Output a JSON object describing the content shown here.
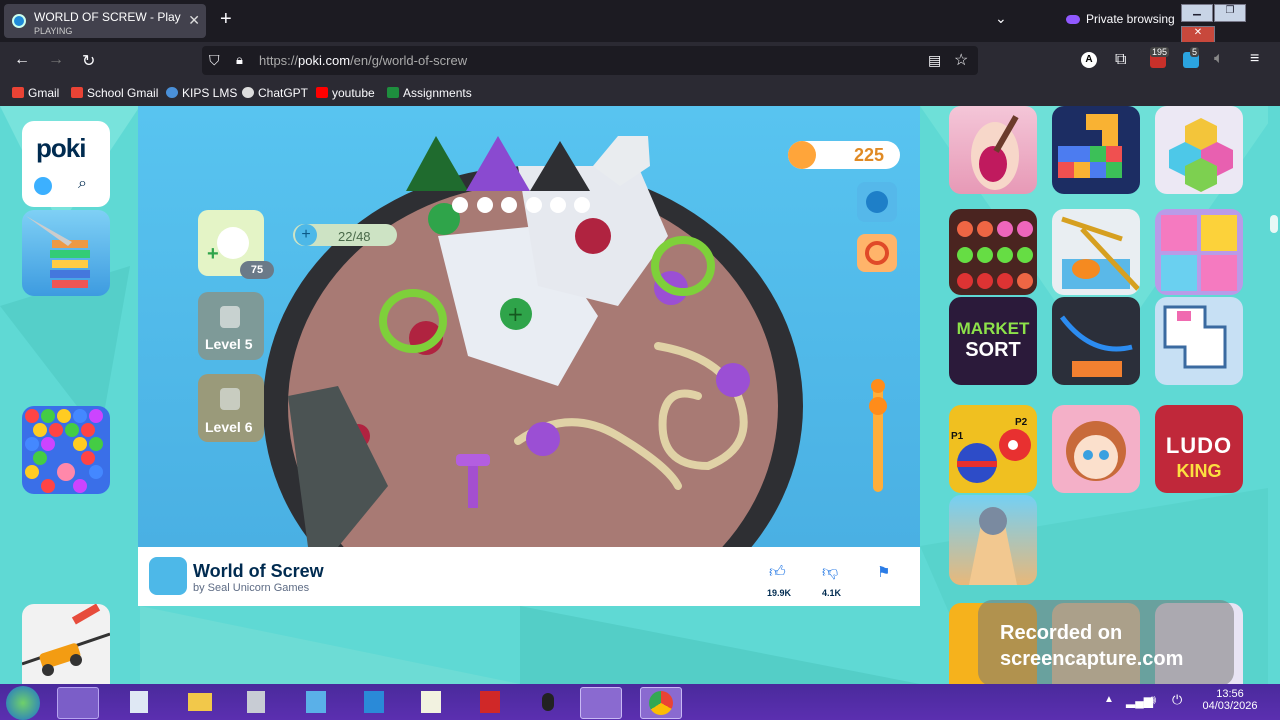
{
  "browser": {
    "tab": {
      "title": "WORLD OF SCREW - Play Onlin",
      "status": "PLAYING"
    },
    "new_tab": "+",
    "private_label": "Private browsing",
    "url": {
      "prefix": "https://",
      "host": "poki.com",
      "path": "/en/g/world-of-screw"
    },
    "extensions": {
      "badge1": "195",
      "badge2": "5"
    },
    "bookmarks": [
      "Gmail",
      "School Gmail",
      "KIPS LMS",
      "ChatGPT",
      "youtube",
      "Assignments"
    ]
  },
  "poki": {
    "logo": "poki"
  },
  "game": {
    "coins": "225",
    "progress": "22/48",
    "hint_cost": "75",
    "levels": [
      "Level 5",
      "Level 6"
    ]
  },
  "game_info": {
    "title": "World of Screw",
    "developer": "by Seal Unicorn Games",
    "likes": "19.9K",
    "dislikes": "4.1K"
  },
  "thumbs_text": {
    "market": "MARKET",
    "sort": "SORT",
    "ludo": "LUDO",
    "king": "KING",
    "p1": "P1",
    "p2": "P2"
  },
  "watermark": {
    "line1": "Recorded on",
    "line2": "screencapture.com"
  },
  "clock": {
    "time": "13:56",
    "date": "04/03/2026"
  }
}
